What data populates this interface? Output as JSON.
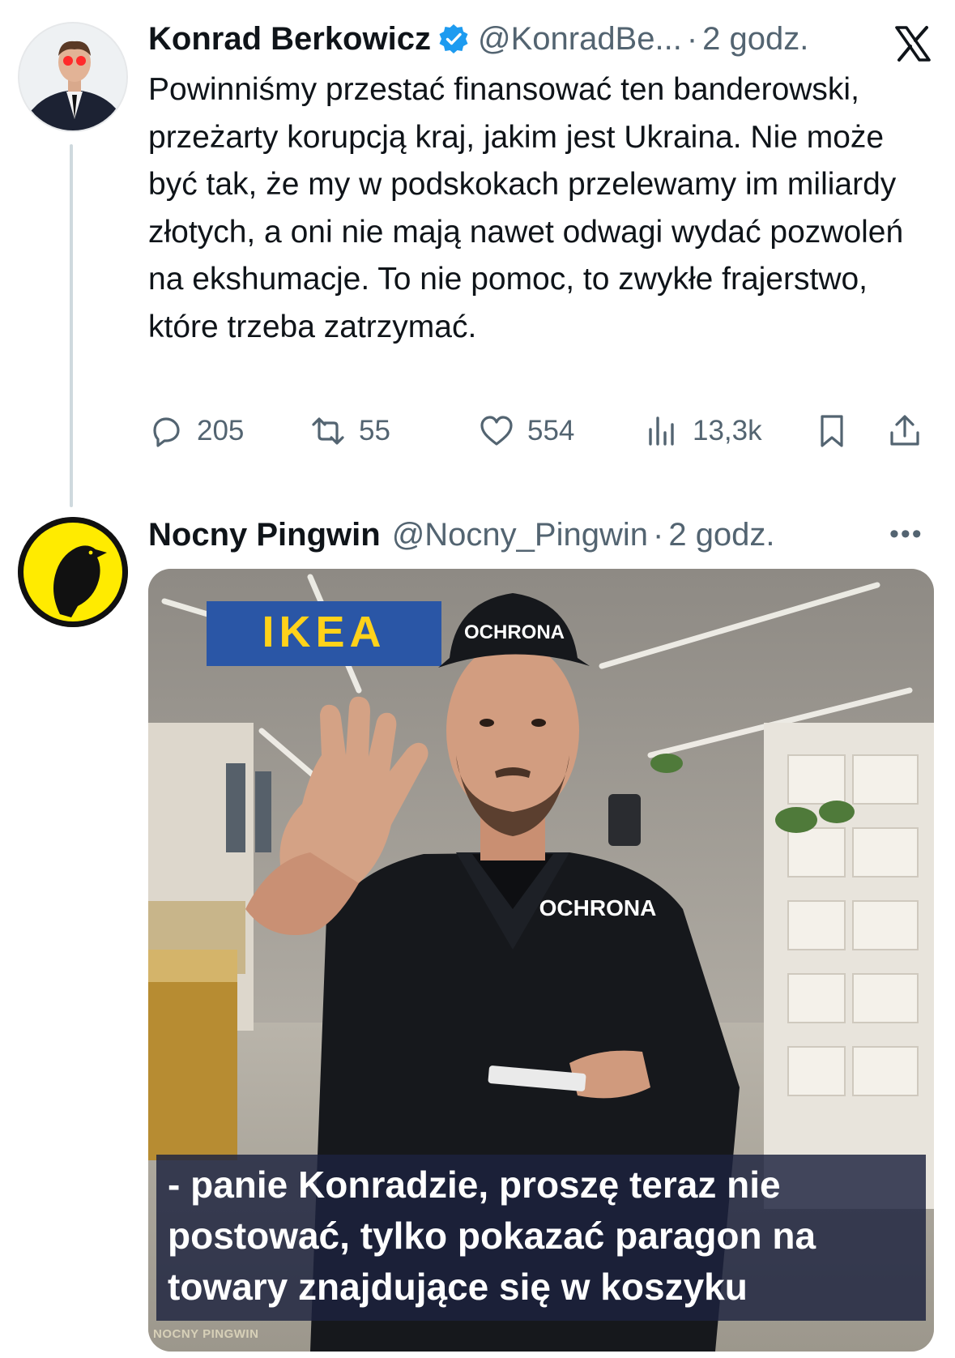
{
  "tweets": [
    {
      "author_name": "Konrad Berkowicz",
      "author_handle": "@KonradBe...",
      "separator": "·",
      "time": "2 godz.",
      "text": "Powinniśmy przestać finansować ten banderowski, przeżarty korupcją kraj, jakim jest Ukraina. Nie może być tak, że my w podskokach przelewamy im miliardy złotych, a oni nie mają nawet odwagi wydać pozwoleń na ekshumacje. To nie pomoc, to zwykłe frajerstwo, które trzeba zatrzymać.",
      "stats": {
        "replies": "205",
        "reposts": "55",
        "likes": "554",
        "views": "13,3k"
      },
      "verified": true
    },
    {
      "author_name": "Nocny Pingwin",
      "author_handle": "@Nocny_Pingwin",
      "separator": "·",
      "time": "2 godz.",
      "media": {
        "store_sign": "IKEA",
        "cap_text": "OCHRONA",
        "shirt_text": "OCHRONA",
        "caption": "- panie Konradzie, proszę teraz nie postować, tylko pokazać paragon na towary znajdujące się w koszyku",
        "watermark": "NOCNY PINGWIN"
      }
    }
  ],
  "icons": [
    "verified-badge-icon",
    "x-logo-icon",
    "reply-icon",
    "repost-icon",
    "like-icon",
    "views-icon",
    "bookmark-icon",
    "share-icon",
    "more-icon"
  ],
  "colors": {
    "text": "#0f1419",
    "secondary": "#536471",
    "verified": "#1d9bf0",
    "thread_line": "#cfd9de",
    "pingwin_yellow": "#ffeb00"
  }
}
